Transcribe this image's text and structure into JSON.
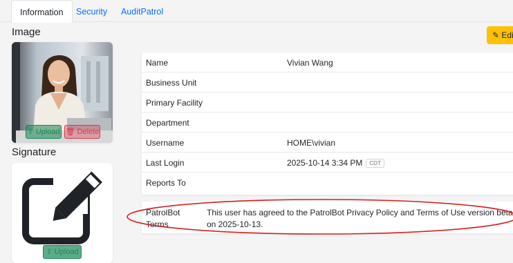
{
  "tabs": [
    {
      "label": "Information",
      "active": true
    },
    {
      "label": "Security",
      "active": false
    },
    {
      "label": "AuditPatrol",
      "active": false
    }
  ],
  "sections": {
    "image_title": "Image",
    "signature_title": "Signature"
  },
  "photo": {
    "upload_label": "Upload",
    "delete_label": "Delete"
  },
  "signature": {
    "upload_label": "Upload",
    "icon": "pen-square-icon"
  },
  "edit_button": {
    "label": "Edi",
    "icon": "pencil-icon"
  },
  "info_rows": [
    {
      "label": "Name",
      "value": "Vivian Wang"
    },
    {
      "label": "Business Unit",
      "value": ""
    },
    {
      "label": "Primary Facility",
      "value": ""
    },
    {
      "label": "Department",
      "value": ""
    },
    {
      "label": "Username",
      "value": "HOME\\vivian"
    },
    {
      "label": "Last Login",
      "value": "2025-10-14 3:34 PM",
      "badge": "CDT"
    },
    {
      "label": "Reports To",
      "value": ""
    }
  ],
  "terms": {
    "label": "PatrolBot Terms",
    "text": "This user has agreed to the PatrolBot Privacy Policy and Terms of Use version beta on 2025-10-13."
  },
  "colors": {
    "link_blue": "#0d6efd",
    "edit_yellow": "#ffc107",
    "success_green": "#198754",
    "danger_red": "#dc3545",
    "annotation_red": "#d61f1f"
  }
}
